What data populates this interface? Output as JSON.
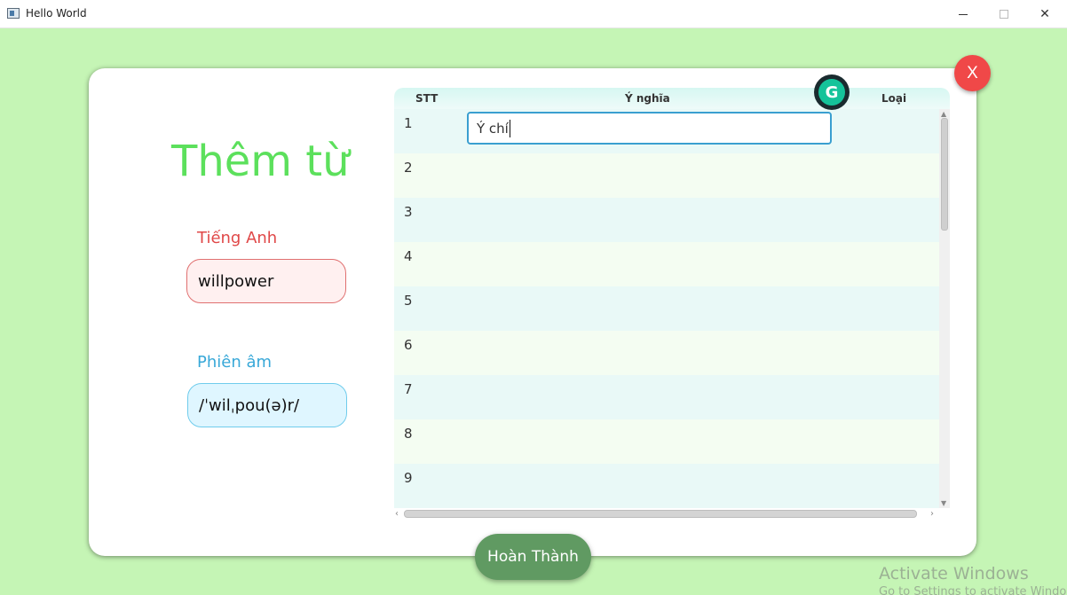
{
  "window": {
    "title": "Hello World",
    "minimize_icon": "minimize-icon",
    "maximize_icon": "maximize-icon",
    "close_label": "✕"
  },
  "card": {
    "close_label": "X",
    "heading": "Thêm từ",
    "english_label": "Tiếng Anh",
    "english_value": "willpower",
    "phonetic_label": "Phiên âm",
    "phonetic_value": "/ˈwilˌpou(ə)r/",
    "done_label": "Hoàn Thành"
  },
  "table": {
    "columns": [
      "STT",
      "Ý nghĩa",
      "Loại"
    ],
    "rows": [
      "1",
      "2",
      "3",
      "4",
      "5",
      "6",
      "7",
      "8",
      "9"
    ],
    "editing_cell_value": "Ý chí"
  },
  "grammarly": {
    "icon": "grammarly-icon",
    "label": "G"
  },
  "watermark": {
    "line1": "Activate Windows",
    "line2": "Go to Settings to activate Windows."
  },
  "colors": {
    "background": "#c5f5b5",
    "heading": "#5ce05c",
    "english_label": "#e04848",
    "phonetic_label": "#38a8d8",
    "close_button": "#f04848",
    "done_button": "#609a62"
  }
}
